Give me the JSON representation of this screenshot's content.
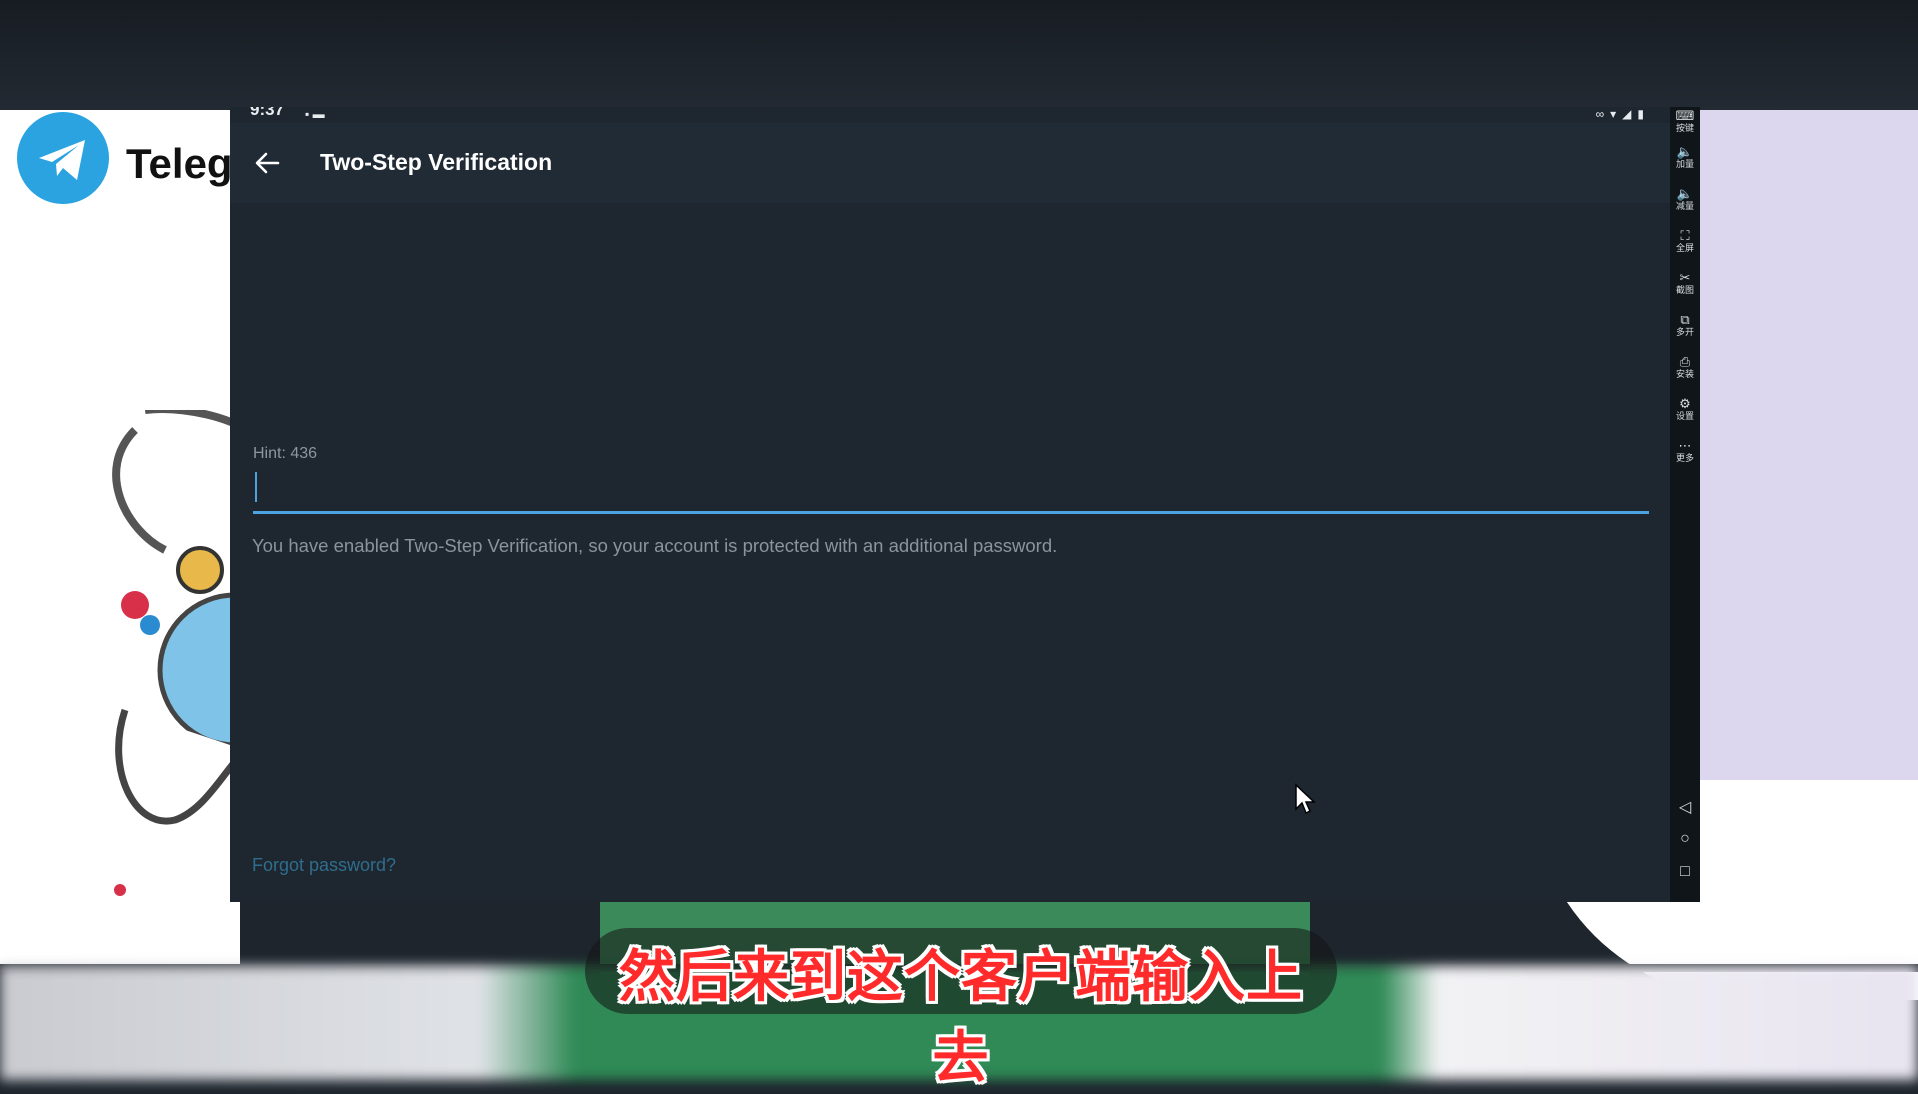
{
  "status_bar": {
    "time": "9:37"
  },
  "app_bar": {
    "title": "Two-Step Verification"
  },
  "password": {
    "hint": "Hint: 436",
    "value": ""
  },
  "description": "You have enabled Two-Step Verification, so your account is protected with an additional password.",
  "forgot_link": "Forgot password?",
  "background": {
    "telegram_wordmark": "Teleg"
  },
  "emulator_toolbar": {
    "items": [
      {
        "icon": "keyboard-icon",
        "label": "按键"
      },
      {
        "icon": "volume-up-icon",
        "label": "加量"
      },
      {
        "icon": "volume-down-icon",
        "label": "减量"
      },
      {
        "icon": "fullscreen-icon",
        "label": "全屏"
      },
      {
        "icon": "scissors-icon",
        "label": "截图"
      },
      {
        "icon": "multi-instance-icon",
        "label": "多开"
      },
      {
        "icon": "install-icon",
        "label": "安装"
      },
      {
        "icon": "settings-icon",
        "label": "设置"
      },
      {
        "icon": "more-icon",
        "label": "更多"
      }
    ]
  },
  "subtitle": "然后来到这个客户端输入上去",
  "colors": {
    "accent": "#4ba3e0",
    "background": "#1e2730",
    "subtitle": "#ff2a2a"
  }
}
